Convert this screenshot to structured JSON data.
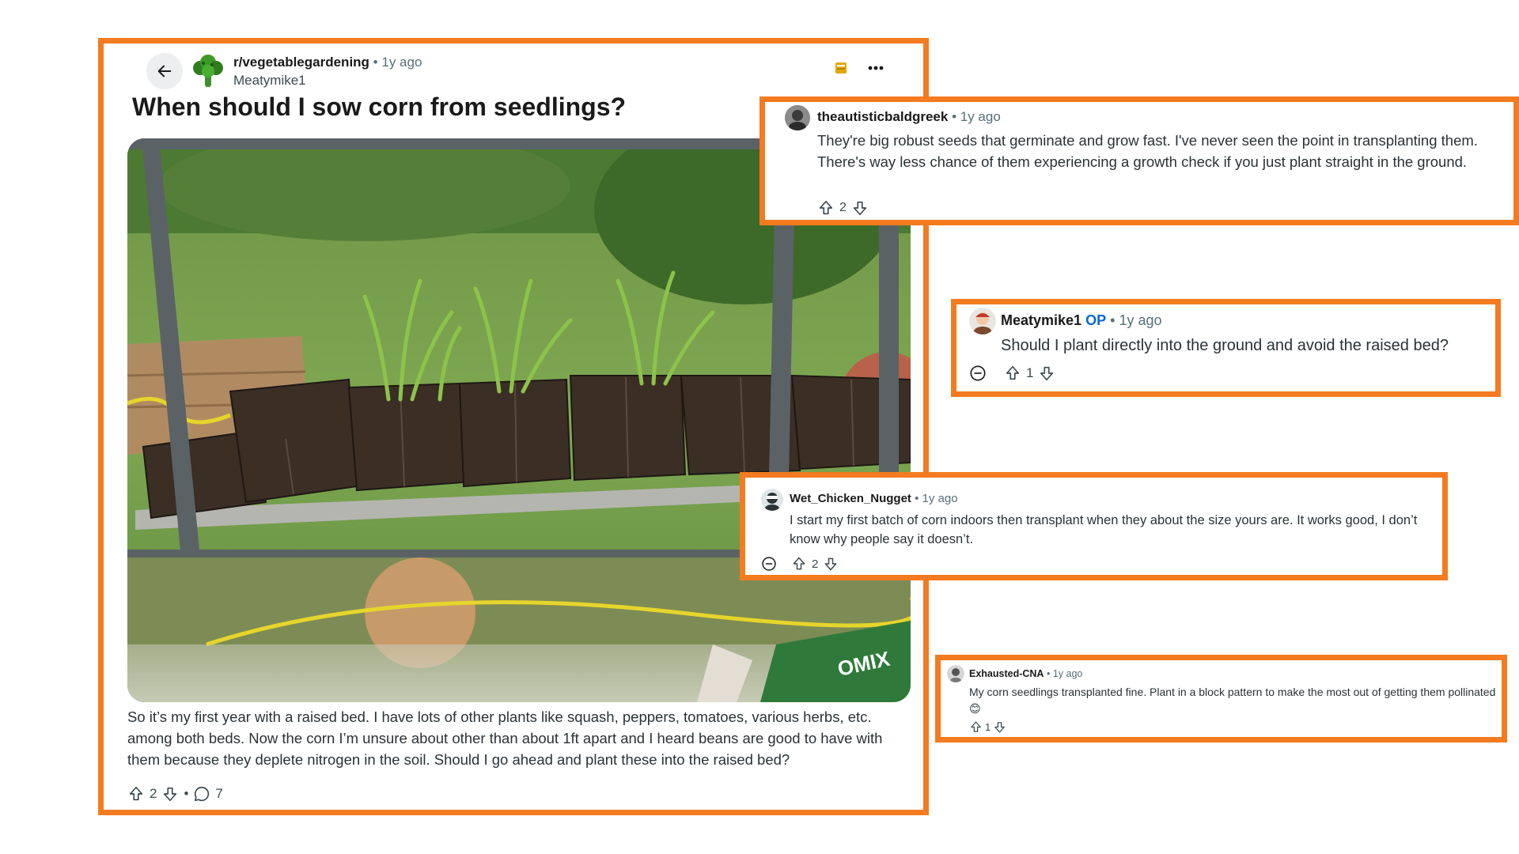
{
  "post": {
    "subreddit": "r/vegetablegardening",
    "age": "1y ago",
    "author": "Meatymike1",
    "title": "When should I sow corn from seedlings?",
    "body": "So it’s my first year with a raised bed. I have lots of other plants like squash, peppers, tomatoes, various herbs, etc. among both beds. Now the corn I’m unsure about other than about 1ft apart and I heard beans are good to have with them because they deplete nitrogen in the soil. Should I go ahead and plant these into the raised bed?",
    "upvotes": "2",
    "comments": "7",
    "image_brand_text": "OMIX"
  },
  "comments": [
    {
      "user": "theautisticbaldgreek",
      "age": "1y ago",
      "text": "They're big robust seeds that germinate and grow fast. I've never seen the point in transplanting them. There's way less chance of them experiencing a growth check if you just plant straight in the ground.",
      "score": "2"
    },
    {
      "user": "Meatymike1",
      "op": "OP",
      "age": "1y ago",
      "text": "Should I plant directly into the ground and avoid the raised bed?",
      "score": "1"
    },
    {
      "user": "Wet_Chicken_Nugget",
      "age": "1y ago",
      "text": "I start my first batch of corn indoors then transplant when they about the size yours are. It works good, I don’t know why people say it doesn’t.",
      "score": "2"
    },
    {
      "user": "Exhausted-CNA",
      "age": "1y ago",
      "text": "My corn seedlings transplanted fine. Plant in a block pattern to make the most out of getting them pollinated 😊",
      "score": "1"
    }
  ],
  "separator": "•",
  "icons": {
    "back": "arrow-left-icon",
    "subreddit_avatar": "broccoli-icon",
    "save": "bookmark-icon",
    "more": "more-horizontal-icon",
    "upvote": "upvote-arrow-icon",
    "downvote": "downvote-arrow-icon",
    "comment": "comment-bubble-icon",
    "collapse": "collapse-minus-icon"
  },
  "colors": {
    "highlight_border": "#f47b20",
    "op_tag": "#0a66d6",
    "save_icon": "#e0a800"
  }
}
